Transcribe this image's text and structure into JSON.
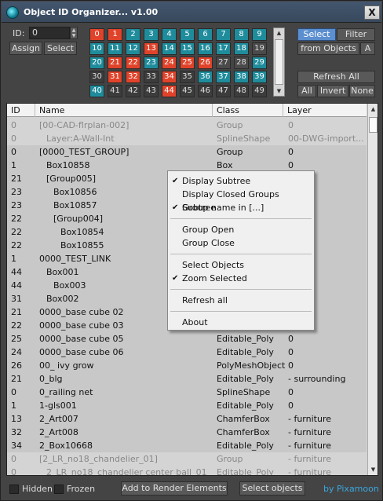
{
  "title": "Object ID Organizer... v1.00",
  "close_label": "X",
  "id_label": "ID:",
  "id_value": "0",
  "assign_label": "Assign",
  "select_label": "Select",
  "grid": [
    {
      "v": "0",
      "c": "red"
    },
    {
      "v": "1",
      "c": "red"
    },
    {
      "v": "2",
      "c": "teal"
    },
    {
      "v": "3",
      "c": "teal"
    },
    {
      "v": "4",
      "c": "teal"
    },
    {
      "v": "5",
      "c": "teal"
    },
    {
      "v": "6",
      "c": "teal"
    },
    {
      "v": "7",
      "c": "teal"
    },
    {
      "v": "8",
      "c": "teal"
    },
    {
      "v": "9",
      "c": "teal"
    },
    {
      "v": "10",
      "c": "teal"
    },
    {
      "v": "11",
      "c": "teal"
    },
    {
      "v": "12",
      "c": "teal"
    },
    {
      "v": "13",
      "c": "red"
    },
    {
      "v": "14",
      "c": "teal"
    },
    {
      "v": "15",
      "c": "teal"
    },
    {
      "v": "16",
      "c": "teal"
    },
    {
      "v": "17",
      "c": "teal"
    },
    {
      "v": "18",
      "c": "teal"
    },
    {
      "v": "19",
      "c": "gray2"
    },
    {
      "v": "20",
      "c": "teal"
    },
    {
      "v": "21",
      "c": "red"
    },
    {
      "v": "22",
      "c": "red"
    },
    {
      "v": "23",
      "c": "teal"
    },
    {
      "v": "24",
      "c": "red"
    },
    {
      "v": "25",
      "c": "red"
    },
    {
      "v": "26",
      "c": "red"
    },
    {
      "v": "27",
      "c": "gray2"
    },
    {
      "v": "28",
      "c": "gray2"
    },
    {
      "v": "29",
      "c": "teal"
    },
    {
      "v": "30",
      "c": "gray"
    },
    {
      "v": "31",
      "c": "red"
    },
    {
      "v": "32",
      "c": "red"
    },
    {
      "v": "33",
      "c": "gray"
    },
    {
      "v": "34",
      "c": "red"
    },
    {
      "v": "35",
      "c": "gray"
    },
    {
      "v": "36",
      "c": "teal"
    },
    {
      "v": "37",
      "c": "teal"
    },
    {
      "v": "38",
      "c": "teal"
    },
    {
      "v": "39",
      "c": "teal"
    },
    {
      "v": "40",
      "c": "teal"
    },
    {
      "v": "41",
      "c": "gray"
    },
    {
      "v": "42",
      "c": "gray"
    },
    {
      "v": "43",
      "c": "gray"
    },
    {
      "v": "44",
      "c": "red"
    },
    {
      "v": "45",
      "c": "gray"
    },
    {
      "v": "46",
      "c": "gray"
    },
    {
      "v": "47",
      "c": "gray"
    },
    {
      "v": "48",
      "c": "gray"
    },
    {
      "v": "49",
      "c": "gray"
    }
  ],
  "right": {
    "select_tab": "Select",
    "filter_tab": "Filter",
    "from_objects": "from Objects",
    "a_label": "A",
    "refresh_all": "Refresh All",
    "all": "All",
    "invert": "Invert",
    "none": "None"
  },
  "table": {
    "headers": [
      "ID",
      "Name",
      "Class",
      "Layer"
    ],
    "rows": [
      {
        "id": "0",
        "name": "[00-CAD-flrplan-002]",
        "indent": 0,
        "cls": "Group",
        "layer": "0",
        "dim": true
      },
      {
        "id": "0",
        "name": "Layer:A-Wall-Int",
        "indent": 1,
        "cls": "SplineShape",
        "layer": "00-DWG-import...",
        "dim": true
      },
      {
        "id": "0",
        "name": "[0000_TEST_GROUP]",
        "indent": 0,
        "cls": "Group",
        "layer": "0",
        "dim": false
      },
      {
        "id": "1",
        "name": "Box10858",
        "indent": 1,
        "cls": "Box",
        "layer": "0",
        "dim": false
      },
      {
        "id": "21",
        "name": "[Group005]",
        "indent": 1,
        "cls": "",
        "layer": "",
        "dim": false
      },
      {
        "id": "23",
        "name": "Box10856",
        "indent": 2,
        "cls": "",
        "layer": "",
        "dim": false
      },
      {
        "id": "23",
        "name": "Box10857",
        "indent": 2,
        "cls": "",
        "layer": "",
        "dim": false
      },
      {
        "id": "22",
        "name": "[Group004]",
        "indent": 2,
        "cls": "",
        "layer": "",
        "dim": false
      },
      {
        "id": "22",
        "name": "Box10854",
        "indent": 3,
        "cls": "",
        "layer": "",
        "dim": false
      },
      {
        "id": "22",
        "name": "Box10855",
        "indent": 3,
        "cls": "",
        "layer": "",
        "dim": false
      },
      {
        "id": "1",
        "name": "0000_TEST_LINK",
        "indent": 0,
        "cls": "",
        "layer": "",
        "dim": false
      },
      {
        "id": "44",
        "name": "Box001",
        "indent": 1,
        "cls": "",
        "layer": "",
        "dim": false
      },
      {
        "id": "44",
        "name": "Box003",
        "indent": 2,
        "cls": "",
        "layer": "",
        "dim": false
      },
      {
        "id": "31",
        "name": "Box002",
        "indent": 1,
        "cls": "",
        "layer": "",
        "dim": false
      },
      {
        "id": "21",
        "name": "0000_base cube 02",
        "indent": 0,
        "cls": "",
        "layer": "",
        "dim": false
      },
      {
        "id": "22",
        "name": "0000_base cube 03",
        "indent": 0,
        "cls": "",
        "layer": "",
        "dim": false
      },
      {
        "id": "25",
        "name": "0000_base cube 05",
        "indent": 0,
        "cls": "Editable_Poly",
        "layer": "0",
        "dim": false
      },
      {
        "id": "24",
        "name": "0000_base cube 06",
        "indent": 0,
        "cls": "Editable_Poly",
        "layer": "0",
        "dim": false
      },
      {
        "id": "26",
        "name": "00_ ivy grow",
        "indent": 0,
        "cls": "PolyMeshObject",
        "layer": "0",
        "dim": false
      },
      {
        "id": "21",
        "name": "0_blg",
        "indent": 0,
        "cls": "Editable_Poly",
        "layer": "- surrounding",
        "dim": false
      },
      {
        "id": "0",
        "name": "0_railing net",
        "indent": 0,
        "cls": "SplineShape",
        "layer": "0",
        "dim": false
      },
      {
        "id": "1",
        "name": "1-gls001",
        "indent": 0,
        "cls": "Editable_Poly",
        "layer": "0",
        "dim": false
      },
      {
        "id": "13",
        "name": "2_Art007",
        "indent": 0,
        "cls": "ChamferBox",
        "layer": "- furniture",
        "dim": false
      },
      {
        "id": "32",
        "name": "2_Art008",
        "indent": 0,
        "cls": "ChamferBox",
        "layer": "- furniture",
        "dim": false
      },
      {
        "id": "34",
        "name": "2_Box10668",
        "indent": 0,
        "cls": "Editable_Poly",
        "layer": "- furniture",
        "dim": false
      },
      {
        "id": "0",
        "name": "[2_LR_no18_chandelier_01]",
        "indent": 0,
        "cls": "Group",
        "layer": "- furniture",
        "dim": true
      },
      {
        "id": "0",
        "name": "2_LR_no18_chandelier center ball_01",
        "indent": 1,
        "cls": "Editable_Poly",
        "layer": "- furniture",
        "dim": true
      }
    ]
  },
  "context_menu": [
    {
      "label": "Display Subtree",
      "checked": true
    },
    {
      "label": "Display Closed Groups Subtree",
      "checked": false
    },
    {
      "label": "Group name in [...]",
      "checked": true
    },
    {
      "sep": true
    },
    {
      "label": "Group Open",
      "checked": false
    },
    {
      "label": "Group Close",
      "checked": false
    },
    {
      "sep": true
    },
    {
      "label": "Select Objects",
      "checked": false
    },
    {
      "label": "Zoom Selected",
      "checked": true
    },
    {
      "sep": true
    },
    {
      "label": "Refresh all",
      "checked": false
    },
    {
      "sep": true
    },
    {
      "label": "About",
      "checked": false
    }
  ],
  "bottom": {
    "hidden": "Hidden",
    "frozen": "Frozen",
    "add_render": "Add to Render Elements",
    "select_objects": "Select objects",
    "brand": "by Pixamoon"
  }
}
